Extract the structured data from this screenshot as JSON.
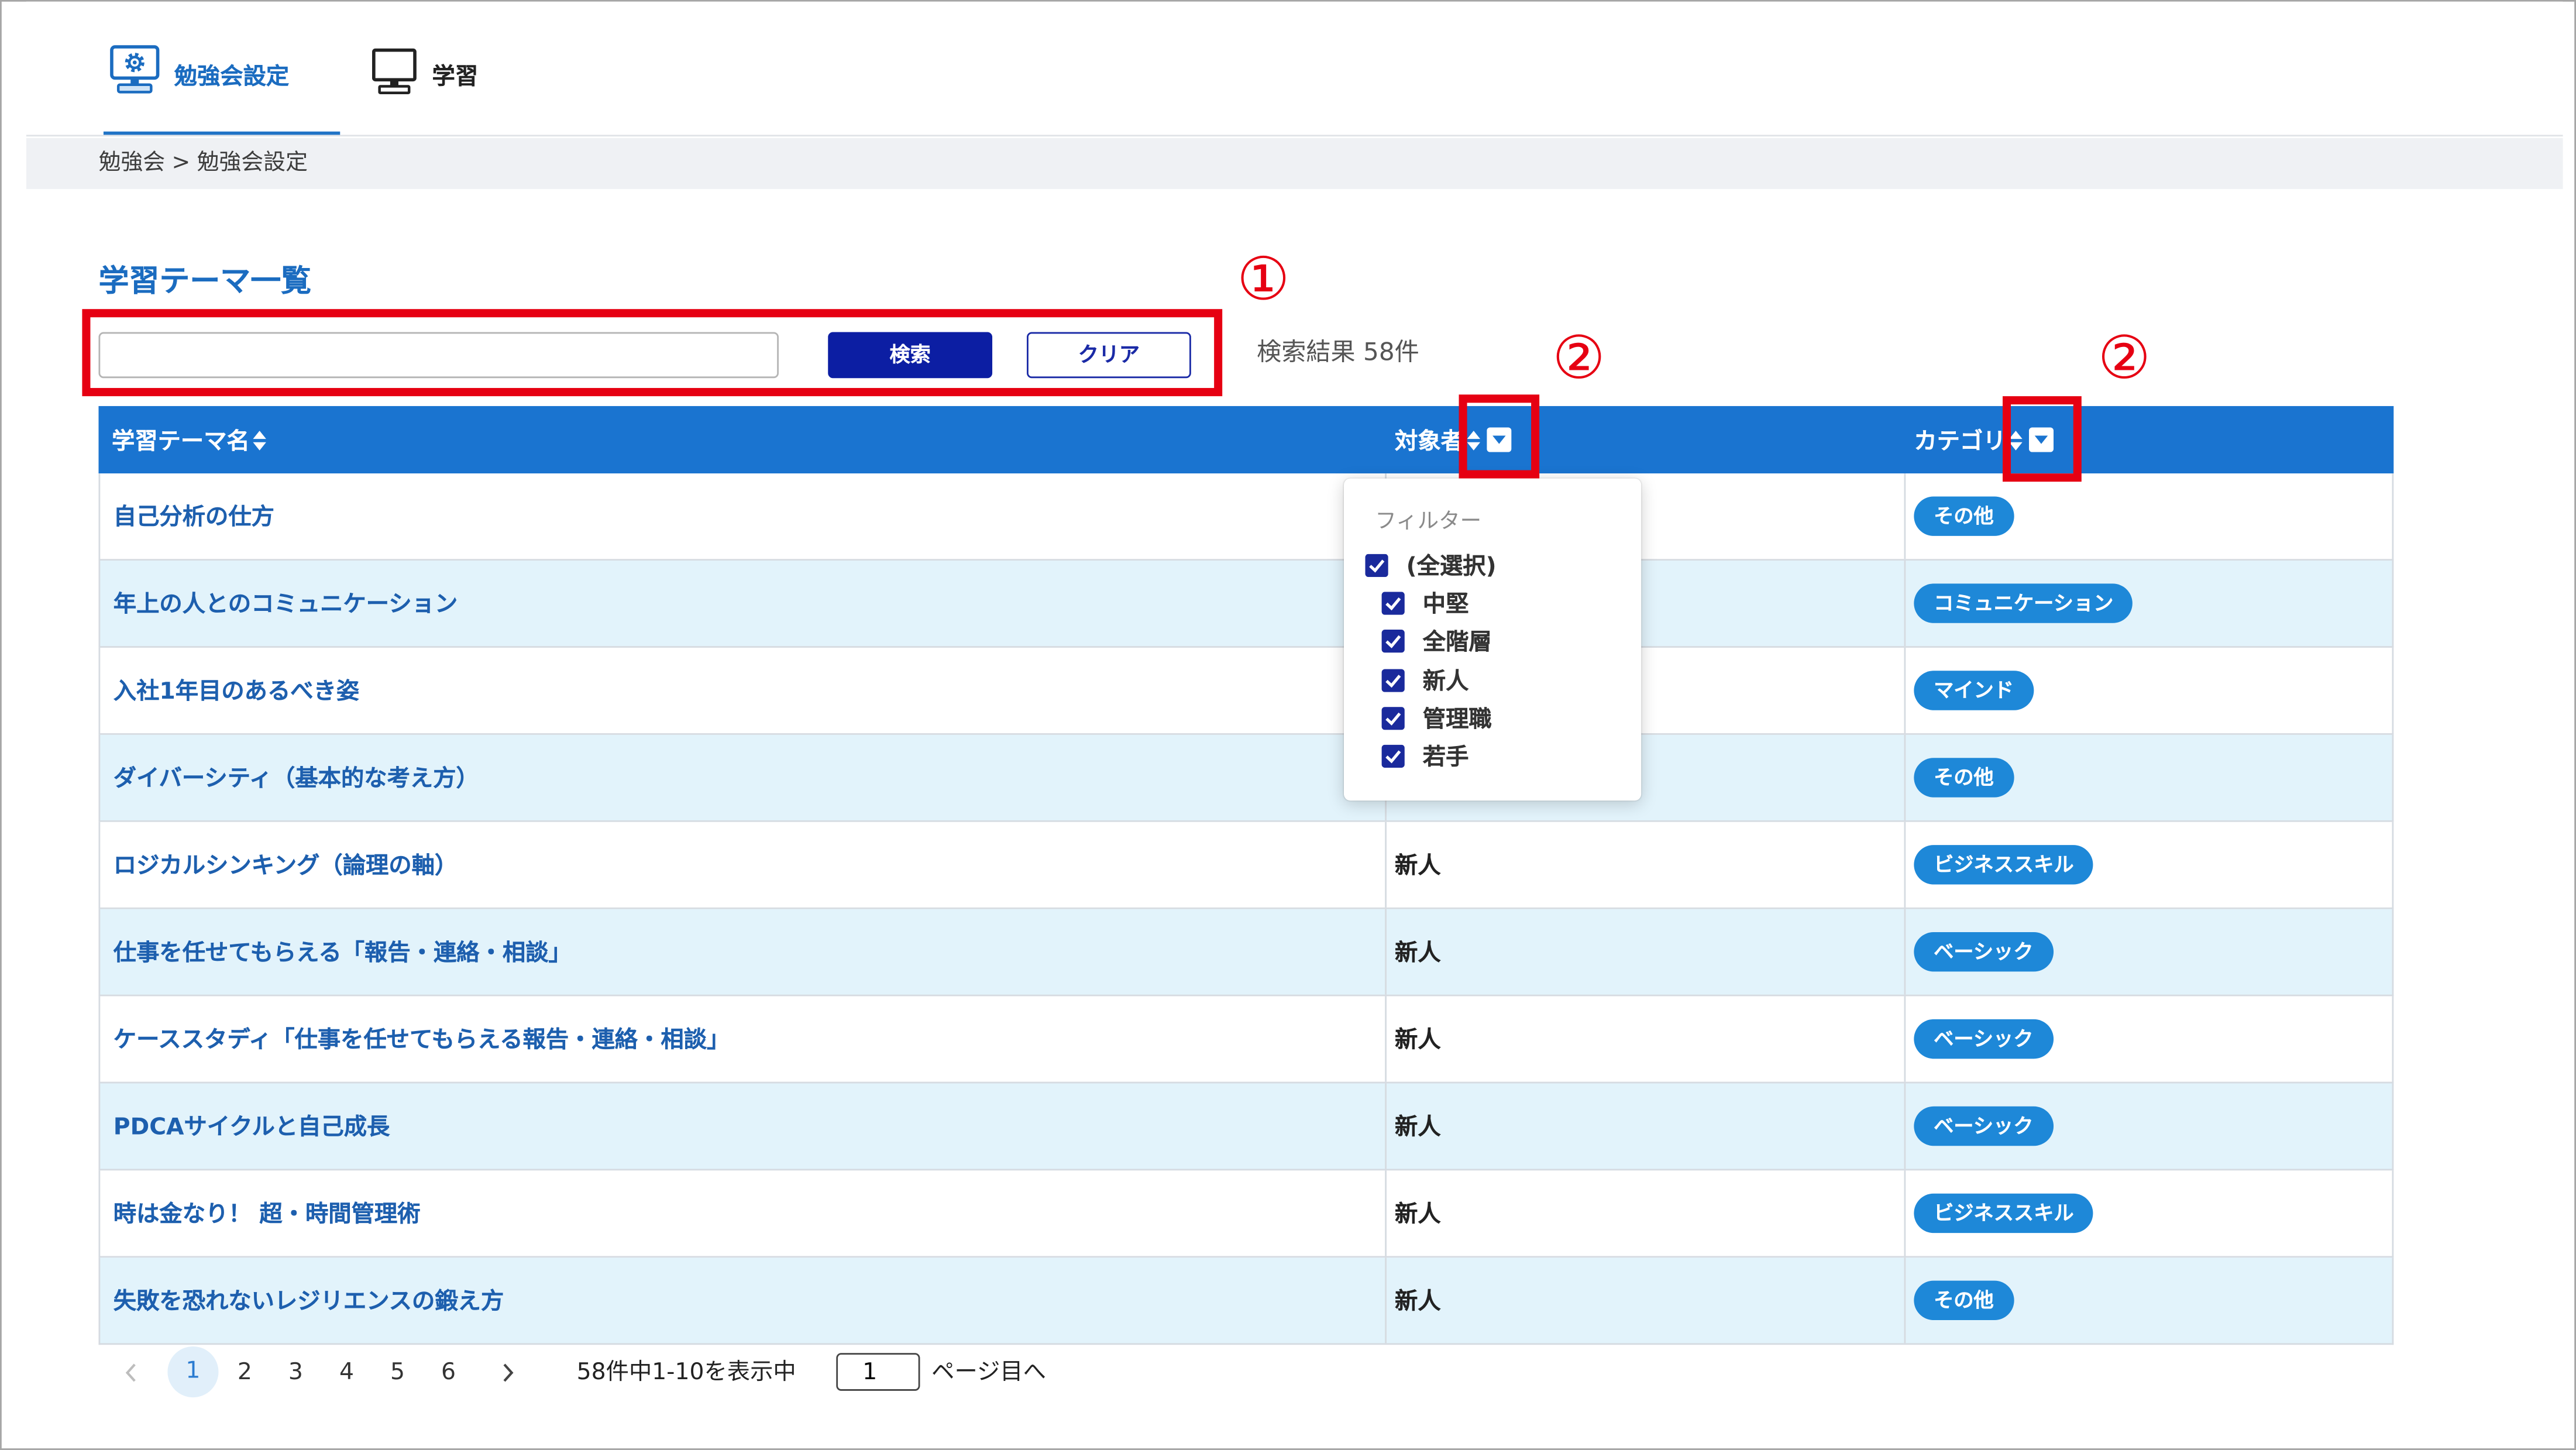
{
  "nav": {
    "tabs": [
      {
        "label": "勉強会設定",
        "icon": "settings-monitor-icon",
        "active": true
      },
      {
        "label": "学習",
        "icon": "monitor-icon",
        "active": false
      }
    ]
  },
  "breadcrumb": {
    "items": [
      "勉強会",
      "勉強会設定"
    ],
    "separator": ">"
  },
  "page_title": "学習テーマ一覧",
  "search": {
    "value": "",
    "search_button": "検索",
    "clear_button": "クリア",
    "result_count": "検索結果 58件"
  },
  "table": {
    "columns": [
      {
        "label": "学習テーマ名",
        "sort_icon": "sort-icon"
      },
      {
        "label": "対象者",
        "sort_icon": "sort-icon",
        "filter_icon": "filter-dropdown-icon"
      },
      {
        "label": "カテゴリ",
        "sort_icon": "sort-icon",
        "filter_icon": "filter-dropdown-icon"
      }
    ],
    "rows": [
      {
        "title": "自己分析の仕方",
        "target": "",
        "category": "その他"
      },
      {
        "title": "年上の人とのコミュニケーション",
        "target": "",
        "category": "コミュニケーション"
      },
      {
        "title": "入社1年目のあるべき姿",
        "target": "",
        "category": "マインド"
      },
      {
        "title": "ダイバーシティ（基本的な考え方）",
        "target": "",
        "category": "その他"
      },
      {
        "title": "ロジカルシンキング（論理の軸）",
        "target": "新人",
        "category": "ビジネススキル"
      },
      {
        "title": "仕事を任せてもらえる「報告・連絡・相談」",
        "target": "新人",
        "category": "ベーシック"
      },
      {
        "title": "ケーススタディ「仕事を任せてもらえる報告・連絡・相談」",
        "target": "新人",
        "category": "ベーシック"
      },
      {
        "title": "PDCAサイクルと自己成長",
        "target": "新人",
        "category": "ベーシック"
      },
      {
        "title": "時は金なり！ 超・時間管理術",
        "target": "新人",
        "category": "ビジネススキル"
      },
      {
        "title": "失敗を恐れないレジリエンスの鍛え方",
        "target": "新人",
        "category": "その他"
      }
    ]
  },
  "filter_dropdown": {
    "title": "フィルター",
    "options": [
      {
        "label": "(全選択)",
        "checked": true
      },
      {
        "label": "中堅",
        "checked": true
      },
      {
        "label": "全階層",
        "checked": true
      },
      {
        "label": "新人",
        "checked": true
      },
      {
        "label": "管理職",
        "checked": true
      },
      {
        "label": "若手",
        "checked": true
      }
    ]
  },
  "pagination": {
    "prev_icon": "chevron-left-icon",
    "pages": [
      "1",
      "2",
      "3",
      "4",
      "5",
      "6"
    ],
    "current_page": 1,
    "next_icon": "chevron-right-icon",
    "summary": "58件中1-10を表示中",
    "page_input": "1",
    "go_label": "ページ目へ"
  },
  "annotations": [
    {
      "label": "①"
    },
    {
      "label": "②"
    },
    {
      "label": "②"
    }
  ],
  "colors": {
    "accent": "#1b6cc0",
    "table_header": "#1a74d0",
    "row_alt": "#e2f3fb",
    "category_badge": "#1e88d8",
    "primary_button": "#0c1ea3",
    "checkbox": "#1a2a9c",
    "annotation": "#e60012",
    "breadcrumb_bg": "#eff1f4"
  }
}
